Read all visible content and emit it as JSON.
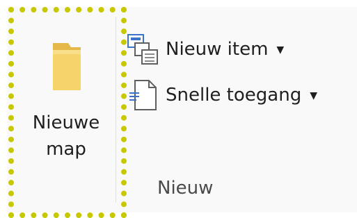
{
  "ribbon": {
    "group_label": "Nieuw",
    "new_folder": {
      "label": "Nieuwe\nmap",
      "icon": "folder-icon"
    },
    "new_item": {
      "label": "Nieuw item",
      "icon": "new-item-icon",
      "dropdown": "chevron-down-icon"
    },
    "easy_access": {
      "label": "Snelle toegang",
      "icon": "easy-access-icon",
      "dropdown": "chevron-down-icon"
    }
  },
  "colors": {
    "highlight": "#c8c800",
    "folder": "#f6d36b",
    "background": "#f9f9f9"
  }
}
